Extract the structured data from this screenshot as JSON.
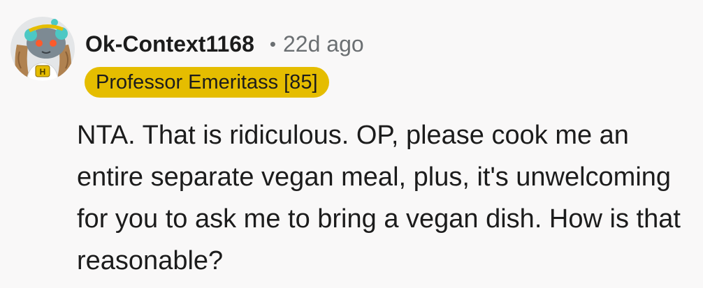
{
  "comment": {
    "avatar": {
      "icon": "snoo-avatar-icon",
      "shirt_letter": "H"
    },
    "username": "Ok-Context1168",
    "separator": "•",
    "timestamp": "22d ago",
    "flair": {
      "text": "Professor Emeritass [85]",
      "color": "#e5bd00"
    },
    "body": "NTA. That is ridiculous. OP, please cook me an entire separate vegan meal, plus, it's unwelcoming for you to ask me to bring a vegan dish. How is that reasonable?"
  }
}
